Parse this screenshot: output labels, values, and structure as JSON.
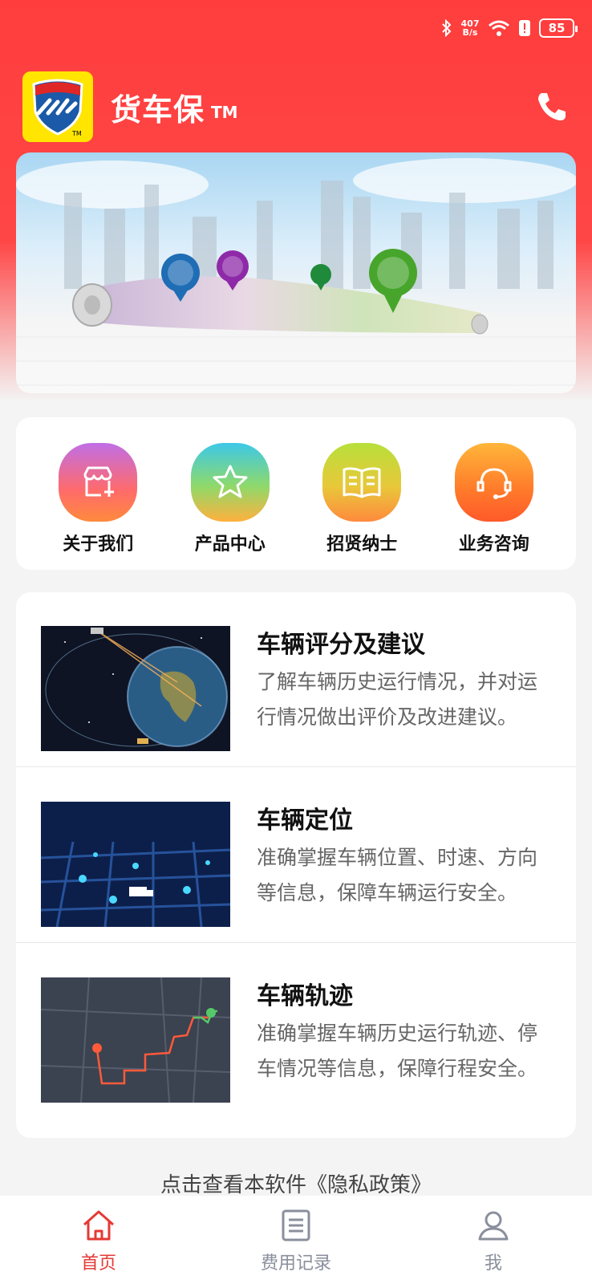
{
  "status_bar": {
    "net_speed_value": "407",
    "net_speed_unit": "B/s",
    "battery": "85"
  },
  "app": {
    "name": "货车保",
    "tm": "TM"
  },
  "quick_links": [
    {
      "label": "关于我们",
      "icon": "store-icon"
    },
    {
      "label": "产品中心",
      "icon": "star-icon"
    },
    {
      "label": "招贤纳士",
      "icon": "book-icon"
    },
    {
      "label": "业务咨询",
      "icon": "headset-icon"
    }
  ],
  "features": [
    {
      "title": "车辆评分及建议",
      "desc": "了解车辆历史运行情况，并对运行情况做出评价及改进建议。",
      "image": "satellite-earth-image"
    },
    {
      "title": "车辆定位",
      "desc": "准确掌握车辆位置、时速、方向等信息，保障车辆运行安全。",
      "image": "location-map-image"
    },
    {
      "title": "车辆轨迹",
      "desc": "准确掌握车辆历史运行轨迹、停车情况等信息，保障行程安全。",
      "image": "track-map-image"
    }
  ],
  "privacy_text": "点击查看本软件《隐私政策》",
  "tabs": [
    {
      "label": "首页",
      "icon": "home-icon",
      "active": true
    },
    {
      "label": "费用记录",
      "icon": "receipt-icon",
      "active": false
    },
    {
      "label": "我",
      "icon": "user-icon",
      "active": false
    }
  ],
  "colors": {
    "brand": "#ff3d3d",
    "active_tab": "#e53935",
    "inactive_tab": "#8a8f9c"
  }
}
